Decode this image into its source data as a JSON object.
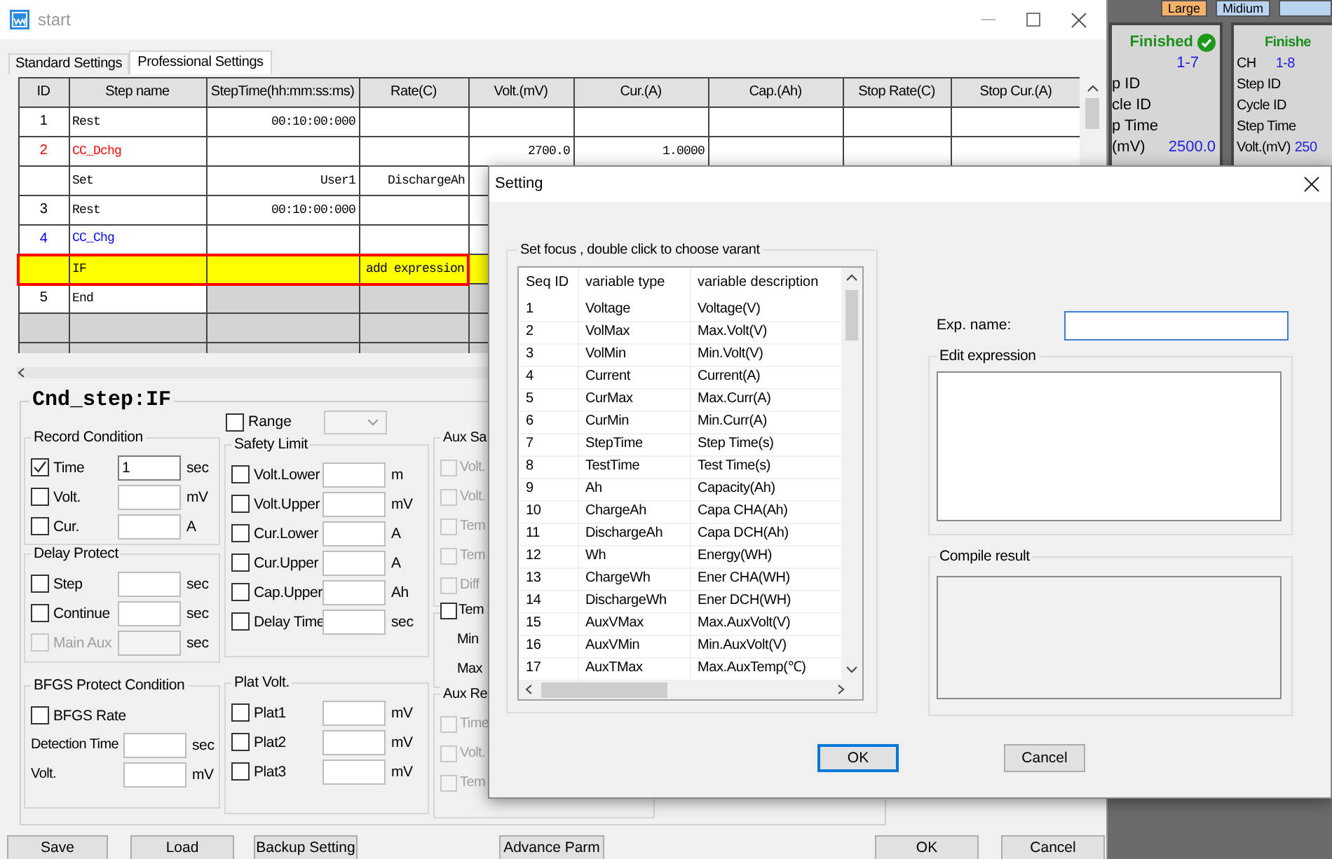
{
  "main_window": {
    "title": "start",
    "tabs": [
      {
        "label": "Standard Settings",
        "selected": false
      },
      {
        "label": "Professional Settings",
        "selected": true
      }
    ],
    "grid": {
      "columns": [
        "ID",
        "Step name",
        "StepTime(hh:mm:ss:ms)",
        "Rate(C)",
        "Volt.(mV)",
        "Cur.(A)",
        "Cap.(Ah)",
        "Stop Rate(C)",
        "Stop Cur.(A)"
      ],
      "rows": [
        {
          "kind": "step",
          "id": "1",
          "color": "#000000",
          "selected": false,
          "cells": [
            "Rest",
            "00:10:00:000",
            null,
            null,
            null,
            null,
            null,
            null
          ]
        },
        {
          "kind": "step",
          "id": "2",
          "color": "#ff0000",
          "selected": false,
          "cells": [
            "CC_Dchg",
            null,
            null,
            "2700.0",
            "1.0000",
            null,
            null,
            null
          ]
        },
        {
          "kind": "sub",
          "color": "#000000",
          "selected": false,
          "cells": [
            "Set",
            "User1",
            "DischargeAh",
            null,
            null,
            null,
            null,
            null
          ]
        },
        {
          "kind": "step",
          "id": "3",
          "color": "#000000",
          "selected": false,
          "cells": [
            "Rest",
            "00:10:00:000",
            null,
            null,
            null,
            null,
            null,
            null
          ]
        },
        {
          "kind": "step",
          "id": "4",
          "color": "#0000ff",
          "selected": false,
          "cells": [
            "CC_Chg",
            null,
            null,
            null,
            null,
            null,
            null,
            null
          ]
        },
        {
          "kind": "sub",
          "color": "#000000",
          "selected": true,
          "cells": [
            "IF",
            null,
            "add expression",
            null,
            null,
            null,
            null,
            null
          ]
        },
        {
          "kind": "end",
          "id": "5",
          "color": "#000000",
          "selected": false,
          "cells": [
            "End",
            null,
            null,
            null,
            null,
            null,
            null,
            null
          ]
        },
        {
          "kind": "empty",
          "selected": false
        },
        {
          "kind": "empty",
          "selected": false
        }
      ]
    },
    "condition": {
      "title": "Cnd_step:IF",
      "range": {
        "label": "Range",
        "checked": false
      },
      "group_columns": [
        [
          {
            "title": "Record Condition",
            "rows": [
              {
                "kind": "check",
                "label": "Time",
                "checked": true,
                "disabled": false,
                "value": "1",
                "unit": "sec"
              },
              {
                "kind": "check",
                "label": "Volt.",
                "checked": false,
                "disabled": false,
                "unit": "mV"
              },
              {
                "kind": "check",
                "label": "Cur.",
                "checked": false,
                "disabled": false,
                "unit": "A"
              }
            ]
          },
          {
            "title": "Delay Protect",
            "rows": [
              {
                "kind": "check",
                "label": "Step",
                "checked": false,
                "disabled": false,
                "unit": "sec"
              },
              {
                "kind": "check",
                "label": "Continue",
                "checked": false,
                "disabled": false,
                "unit": "sec"
              },
              {
                "kind": "check",
                "label": "Main Aux",
                "checked": false,
                "disabled": true,
                "unit": "sec"
              }
            ]
          },
          {
            "title": "BFGS Protect Condition",
            "rows": [
              {
                "kind": "check_only",
                "label": "BFGS Rate",
                "checked": false,
                "disabled": false
              },
              {
                "kind": "field",
                "label": "Detection Time",
                "unit": "sec"
              },
              {
                "kind": "field",
                "label": "Volt.",
                "unit": "mV"
              }
            ]
          }
        ],
        [
          {
            "title": "Safety Limit",
            "rows": [
              {
                "kind": "check",
                "label": "Volt.Lower",
                "checked": false,
                "disabled": false,
                "unit": "m"
              },
              {
                "kind": "check",
                "label": "Volt.Upper",
                "checked": false,
                "disabled": false,
                "unit": "mV"
              },
              {
                "kind": "check",
                "label": "Cur.Lower",
                "checked": false,
                "disabled": false,
                "unit": "A"
              },
              {
                "kind": "check",
                "label": "Cur.Upper",
                "checked": false,
                "disabled": false,
                "unit": "A"
              },
              {
                "kind": "check",
                "label": "Cap.Upper",
                "checked": false,
                "disabled": false,
                "unit": "Ah"
              },
              {
                "kind": "check",
                "label": "Delay Time",
                "checked": false,
                "disabled": false,
                "unit": "sec"
              }
            ]
          },
          {
            "title": "Plat Volt.",
            "rows": [
              {
                "kind": "check",
                "label": "Plat1",
                "checked": false,
                "disabled": false,
                "unit": "mV"
              },
              {
                "kind": "check",
                "label": "Plat2",
                "checked": false,
                "disabled": false,
                "unit": "mV"
              },
              {
                "kind": "check",
                "label": "Plat3",
                "checked": false,
                "disabled": false,
                "unit": "mV"
              }
            ]
          }
        ],
        [
          {
            "title": "Aux Sa",
            "rows": [
              {
                "kind": "check_only",
                "label": "Volt.",
                "checked": false,
                "disabled": true
              },
              {
                "kind": "check_only",
                "label": "Volt.",
                "checked": false,
                "disabled": true
              },
              {
                "kind": "check_only",
                "label": "Tem",
                "checked": false,
                "disabled": true
              },
              {
                "kind": "check_only",
                "label": "Tem",
                "checked": false,
                "disabled": true
              },
              {
                "kind": "check_only",
                "label": "Diff",
                "checked": false,
                "disabled": true
              }
            ]
          },
          {
            "title": "Tem",
            "checked": false,
            "rows": [
              {
                "kind": "text",
                "label": "Min"
              },
              {
                "kind": "text",
                "label": "Max"
              }
            ]
          },
          {
            "title": "Aux Re",
            "rows": [
              {
                "kind": "check_only",
                "label": "Time",
                "checked": false,
                "disabled": true
              },
              {
                "kind": "check_only",
                "label": "Volt.",
                "checked": false,
                "disabled": true
              },
              {
                "kind": "check_only",
                "label": "Tem",
                "checked": false,
                "disabled": true
              }
            ]
          }
        ]
      ]
    },
    "file_buttons": [
      "Save",
      "Load",
      "Backup Setting"
    ],
    "advance_button": "Advance Parm",
    "dialog_buttons": [
      "OK",
      "Cancel"
    ]
  },
  "channel_panel": {
    "view_buttons": [
      {
        "label": "Large",
        "selected": true
      },
      {
        "label": "Midium",
        "selected": false
      },
      {
        "selected": false
      }
    ],
    "cards": [
      {
        "status": "Finished",
        "done": true,
        "channel": "1-7",
        "fields": [
          {
            "label": "p ID"
          },
          {
            "label": "cle ID"
          },
          {
            "label": "p Time"
          },
          {
            "label": "(mV)",
            "value": "2500.0"
          }
        ]
      },
      {
        "status": "Finishe",
        "done": false,
        "ch_label": "CH",
        "channel": "1-8",
        "fields": [
          {
            "label": "Step ID"
          },
          {
            "label": "Cycle ID"
          },
          {
            "label": "Step Time"
          },
          {
            "label": "Volt.(mV)",
            "value": "250"
          }
        ]
      }
    ]
  },
  "dialog": {
    "title": "Setting",
    "variables": {
      "title": "Set focus , double click to choose varant",
      "columns": [
        "Seq ID",
        "variable type",
        "variable description"
      ],
      "rows": [
        [
          "1",
          "Voltage",
          "Voltage(V)"
        ],
        [
          "2",
          "VolMax",
          "Max.Volt(V)"
        ],
        [
          "3",
          "VolMin",
          "Min.Volt(V)"
        ],
        [
          "4",
          "Current",
          "Current(A)"
        ],
        [
          "5",
          "CurMax",
          "Max.Curr(A)"
        ],
        [
          "6",
          "CurMin",
          "Min.Curr(A)"
        ],
        [
          "7",
          "StepTime",
          "Step Time(s)"
        ],
        [
          "8",
          "TestTime",
          "Test Time(s)"
        ],
        [
          "9",
          "Ah",
          "Capacity(Ah)"
        ],
        [
          "10",
          "ChargeAh",
          "Capa CHA(Ah)"
        ],
        [
          "11",
          "DischargeAh",
          "Capa DCH(Ah)"
        ],
        [
          "12",
          "Wh",
          "Energy(WH)"
        ],
        [
          "13",
          "ChargeWh",
          "Ener CHA(WH)"
        ],
        [
          "14",
          "DischargeWh",
          "Ener DCH(WH)"
        ],
        [
          "15",
          "AuxVMax",
          "Max.AuxVolt(V)"
        ],
        [
          "16",
          "AuxVMin",
          "Min.AuxVolt(V)"
        ],
        [
          "17",
          "AuxTMax",
          "Max.AuxTemp(℃)"
        ]
      ]
    },
    "exp_name": {
      "label": "Exp. name:"
    },
    "edit_expression": {
      "title": "Edit expression"
    },
    "compile_result": {
      "title": "Compile result"
    },
    "buttons": [
      {
        "label": "OK",
        "focused": true
      },
      {
        "label": "Cancel",
        "focused": false
      }
    ]
  }
}
